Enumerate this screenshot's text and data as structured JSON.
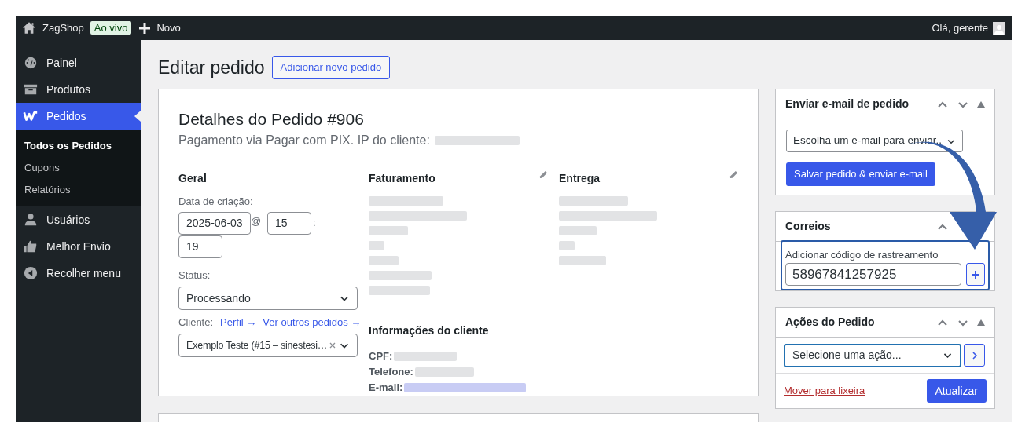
{
  "admin_bar": {
    "site_name": "ZagShop",
    "live_badge": "Ao vivo",
    "new_label": "Novo",
    "greeting": "Olá, gerente"
  },
  "sidebar": {
    "items": [
      {
        "label": "Painel",
        "selected": false
      },
      {
        "label": "Produtos",
        "selected": false
      },
      {
        "label": "Pedidos",
        "selected": true,
        "children": [
          {
            "label": "Todos os Pedidos",
            "selected": true
          },
          {
            "label": "Cupons",
            "selected": false
          },
          {
            "label": "Relatórios",
            "selected": false
          }
        ]
      },
      {
        "label": "Usuários",
        "selected": false
      },
      {
        "label": "Melhor Envio",
        "selected": false
      },
      {
        "label": "Recolher menu",
        "selected": false
      }
    ]
  },
  "page": {
    "title": "Editar pedido",
    "add_button": "Adicionar novo pedido"
  },
  "order": {
    "heading": "Detalhes do Pedido #906",
    "subtitle": "Pagamento via Pagar com PIX. IP do cliente:",
    "general": {
      "title": "Geral",
      "date_label": "Data de criação:",
      "date": "2025-06-03",
      "at": "@",
      "hour": "15",
      "colon": ":",
      "minute": "19",
      "status_label": "Status:",
      "status": "Processando",
      "customer_label": "Cliente:",
      "profile_link": "Perfil →",
      "orders_link": "Ver outros pedidos →",
      "customer": "Exemplo Teste (#15 – sinestesi…"
    },
    "billing": {
      "title": "Faturamento"
    },
    "shipping": {
      "title": "Entrega"
    },
    "customer_info": {
      "title": "Informações do cliente",
      "fields": [
        "CPF:",
        "Telefone:",
        "E-mail:"
      ]
    }
  },
  "email_box": {
    "title": "Enviar e-mail de pedido",
    "select": "Escolha um e-mail para enviar..",
    "button": "Salvar pedido & enviar e-mail"
  },
  "correios_box": {
    "title": "Correios",
    "field_label": "Adicionar código de rastreamento",
    "tracking_code": "58967841257925",
    "focused": true
  },
  "actions_box": {
    "title": "Ações do Pedido",
    "select": "Selecione uma ação...",
    "focused": true,
    "trash_link": "Mover para lixeira",
    "update_button": "Atualizar"
  }
}
